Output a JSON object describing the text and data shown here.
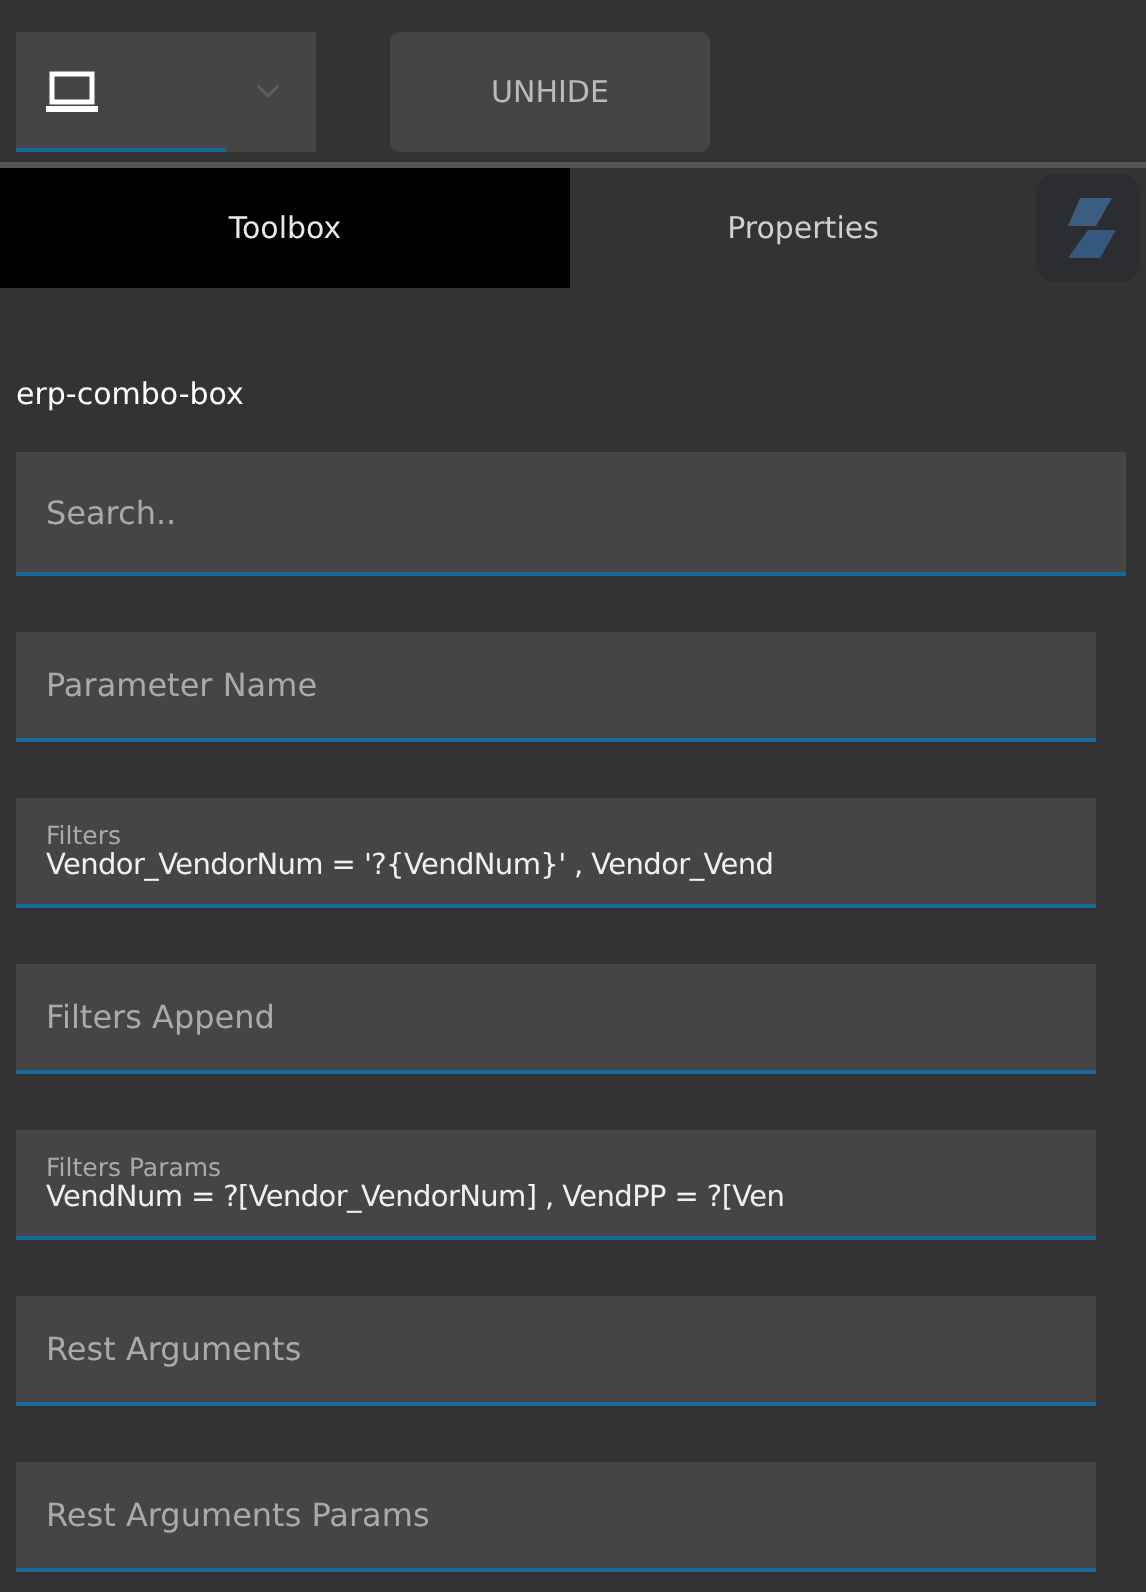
{
  "toolbar": {
    "device_select": {
      "kind": "laptop"
    },
    "unhide_button": "UNHIDE"
  },
  "tabs": [
    {
      "label": "Toolbox",
      "selected": true
    },
    {
      "label": "Properties",
      "selected": false
    }
  ],
  "component_name": "erp-combo-box",
  "search": {
    "placeholder": "Search.."
  },
  "fields": [
    {
      "label": "Parameter Name"
    },
    {
      "label": "Filters",
      "value": "Vendor_VendorNum = '?{VendNum}' , Vendor_Vend"
    },
    {
      "label": "Filters Append"
    },
    {
      "label": "Filters Params",
      "value": "VendNum = ?[Vendor_VendorNum] , VendPP = ?[Ven"
    },
    {
      "label": "Rest Arguments"
    },
    {
      "label": "Rest Arguments Params"
    }
  ]
}
